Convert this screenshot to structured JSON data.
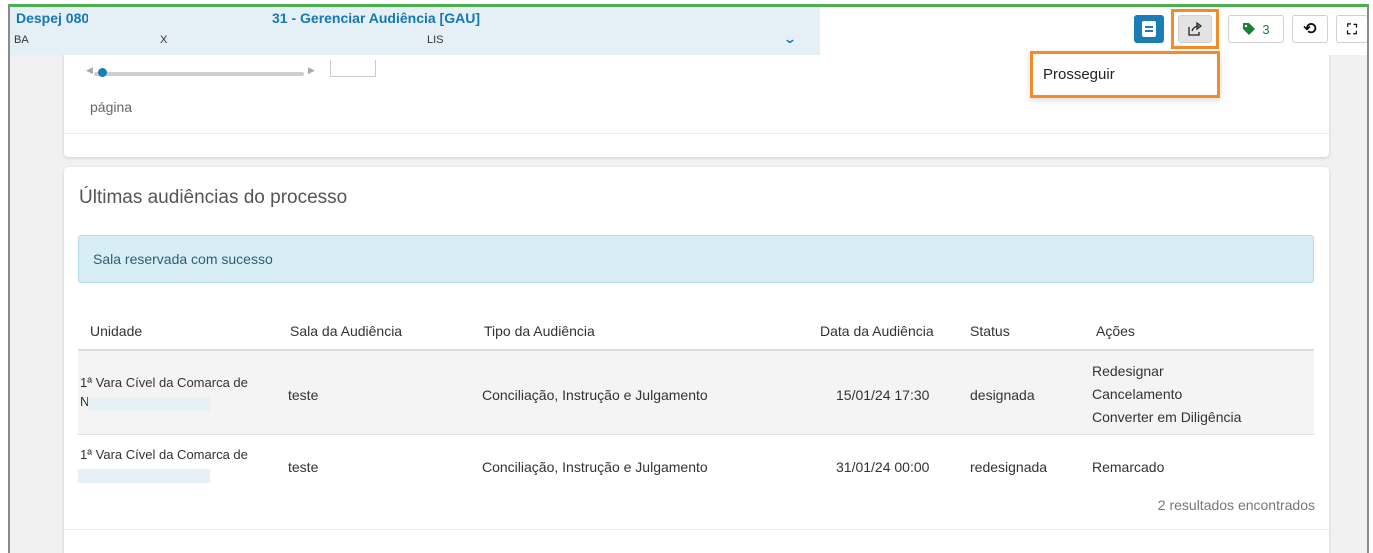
{
  "window": {
    "title_prefix": "Despej 080:",
    "title_suffix": "31 - Gerenciar Audiência [GAU]",
    "subtitle_parts": [
      "BA",
      "X",
      "LIS"
    ]
  },
  "toolbar": {
    "tags_count": "3",
    "icons": [
      "document-icon",
      "share-icon",
      "tag-icon",
      "history-icon",
      "fullscreen-icon",
      "chevron-down-icon"
    ]
  },
  "dropdown": {
    "items": [
      "Prosseguir"
    ]
  },
  "pagination": {
    "label": "página"
  },
  "hearings": {
    "title": "Últimas audiências do processo",
    "alert": "Sala reservada com sucesso",
    "columns": [
      "Unidade",
      "Sala da Audiência",
      "Tipo da Audiência",
      "Data da Audiência",
      "Status",
      "Ações"
    ],
    "rows": [
      {
        "unidade": "1ª Vara Cível da Comarca de",
        "unidade_cont": "N",
        "sala": "teste",
        "tipo": "Conciliação, Instrução e Julgamento",
        "data": "15/01/24 17:30",
        "status": "designada",
        "acoes": [
          "Redesignar",
          "Cancelamento",
          "Converter em Diligência"
        ]
      },
      {
        "unidade": "1ª Vara Cível da Comarca de",
        "unidade_cont": "",
        "sala": "teste",
        "tipo": "Conciliação, Instrução e Julgamento",
        "data": "31/01/24 00:00",
        "status": "redesignada",
        "acoes": [
          "Remarcado"
        ]
      }
    ],
    "results_text": "2 resultados encontrados"
  },
  "colors": {
    "accent": "#1b7db5",
    "highlight": "#f28c28",
    "tag_green": "#1a7f37",
    "alert_bg": "#d8eef6"
  }
}
